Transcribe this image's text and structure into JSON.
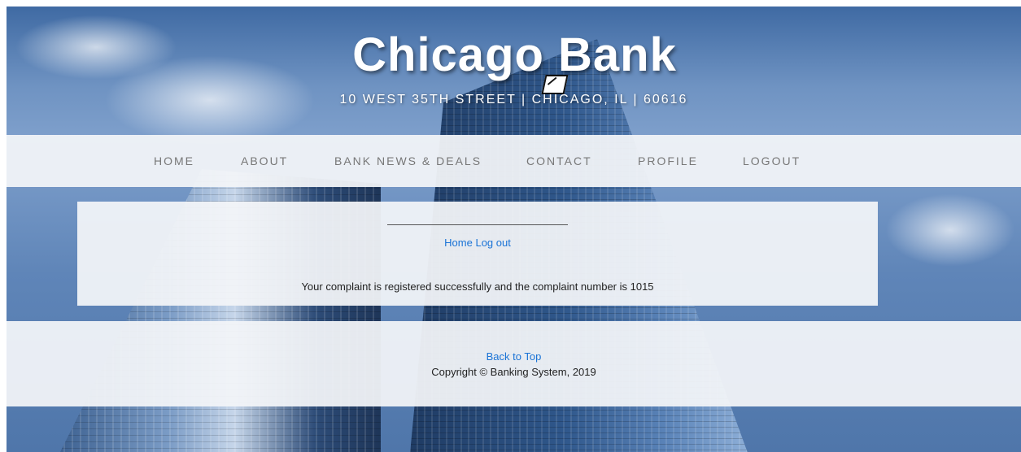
{
  "header": {
    "title": "Chicago Bank",
    "address": "10 WEST 35TH STREET | CHICAGO, IL | 60616"
  },
  "nav": {
    "items": [
      {
        "label": "HOME"
      },
      {
        "label": "ABOUT"
      },
      {
        "label": "BANK NEWS & DEALS"
      },
      {
        "label": "CONTACT"
      },
      {
        "label": "PROFILE"
      },
      {
        "label": "LOGOUT"
      }
    ]
  },
  "main": {
    "home_link": "Home",
    "logout_link": "Log out",
    "message": "Your complaint is registered successfully and the complaint number is 1015"
  },
  "footer": {
    "back_to_top": "Back to Top",
    "copyright": "Copyright © Banking System, 2019"
  },
  "colors": {
    "link": "#1a73d6",
    "nav_text": "#777777",
    "panel_bg": "#f2f4f8"
  }
}
